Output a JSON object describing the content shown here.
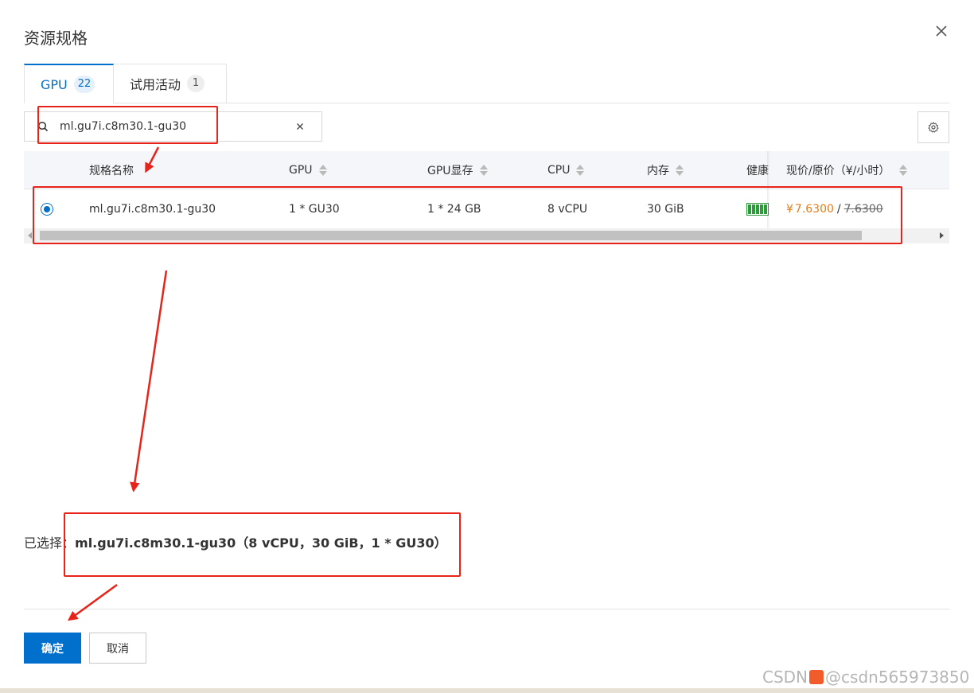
{
  "dialog": {
    "title": "资源规格"
  },
  "tabs": [
    {
      "label": "GPU",
      "count": "22"
    },
    {
      "label": "试用活动",
      "count": "1"
    }
  ],
  "search": {
    "value": "ml.gu7i.c8m30.1-gu30"
  },
  "table": {
    "columns": [
      "规格名称",
      "GPU",
      "GPU显存",
      "CPU",
      "内存",
      "健康",
      "现价/原价（¥/小时）"
    ],
    "rows": [
      {
        "name": "ml.gu7i.c8m30.1-gu30",
        "gpu": "1 * GU30",
        "gpu_mem": "1 * 24 GB",
        "cpu": "8 vCPU",
        "memory": "30 GiB",
        "health": "healthy",
        "currency": "¥",
        "price_now": "7.6300",
        "price_sep": "/",
        "price_orig": "7.6300",
        "selected": true
      }
    ]
  },
  "selection": {
    "label": "已选择：",
    "value": "ml.gu7i.c8m30.1-gu30（8 vCPU，30 GiB，1 * GU30）"
  },
  "footer": {
    "confirm_label": "确定",
    "cancel_label": "取消"
  },
  "watermark": {
    "text_left": "CSDN",
    "text_right": "@csdn565973850"
  },
  "colors": {
    "accent": "#0070cc",
    "price": "#e87b17",
    "annotation_red": "#e8231a",
    "health_green": "#2c9a3a"
  }
}
